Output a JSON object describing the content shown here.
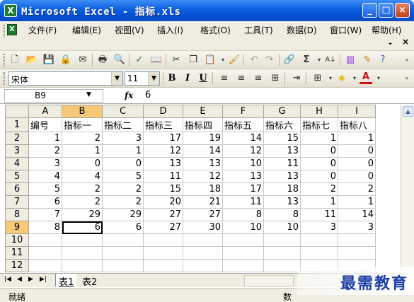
{
  "window": {
    "title": "Microsoft Excel - 指标.xls",
    "app_icon": "X",
    "controls": {
      "minimize": "_",
      "maximize": "□",
      "close": "×"
    }
  },
  "menu": {
    "items": [
      "文件(F)",
      "编辑(E)",
      "视图(V)",
      "插入(I)",
      "格式(O)",
      "工具(T)",
      "数据(D)",
      "窗口(W)",
      "帮助(H)"
    ],
    "doc_min": "-",
    "doc_restore": "❐",
    "doc_close": "×"
  },
  "format_toolbar": {
    "font_name": "宋体",
    "font_size": "11",
    "bold": "B",
    "italic": "I",
    "underline": "U"
  },
  "formula_bar": {
    "name_box": "B9",
    "fx_label": "fx",
    "content": "6"
  },
  "sheet": {
    "columns": [
      "A",
      "B",
      "C",
      "D",
      "E",
      "F",
      "G",
      "H",
      "I"
    ],
    "row_numbers": [
      "1",
      "2",
      "3",
      "4",
      "5",
      "6",
      "7",
      "8",
      "9",
      "10",
      "11",
      "12"
    ],
    "header_row": [
      "编号",
      "指标一",
      "指标二",
      "指标三",
      "指标四",
      "指标五",
      "指标六",
      "指标七",
      "指标八"
    ],
    "rows": [
      [
        "1",
        "2",
        "3",
        "17",
        "19",
        "14",
        "15",
        "1",
        "1"
      ],
      [
        "2",
        "1",
        "1",
        "12",
        "14",
        "12",
        "13",
        "0",
        "0"
      ],
      [
        "3",
        "0",
        "0",
        "13",
        "13",
        "10",
        "11",
        "0",
        "0"
      ],
      [
        "4",
        "4",
        "5",
        "11",
        "12",
        "13",
        "13",
        "0",
        "0"
      ],
      [
        "5",
        "2",
        "2",
        "15",
        "18",
        "17",
        "18",
        "2",
        "2"
      ],
      [
        "6",
        "2",
        "2",
        "20",
        "21",
        "11",
        "13",
        "1",
        "1"
      ],
      [
        "7",
        "29",
        "29",
        "27",
        "27",
        "8",
        "8",
        "11",
        "14"
      ],
      [
        "8",
        "6",
        "6",
        "27",
        "30",
        "10",
        "10",
        "3",
        "3"
      ]
    ],
    "selected_cell": "B9"
  },
  "tabs": {
    "sheets": [
      "表1",
      "表2"
    ],
    "active": "表1"
  },
  "status": {
    "text": "就绪",
    "right_text": "数"
  },
  "watermark": "最需教育",
  "colors": {
    "titlebar": "#0a5fe0",
    "selected_header": "#f8c879",
    "chrome": "#efede2"
  }
}
